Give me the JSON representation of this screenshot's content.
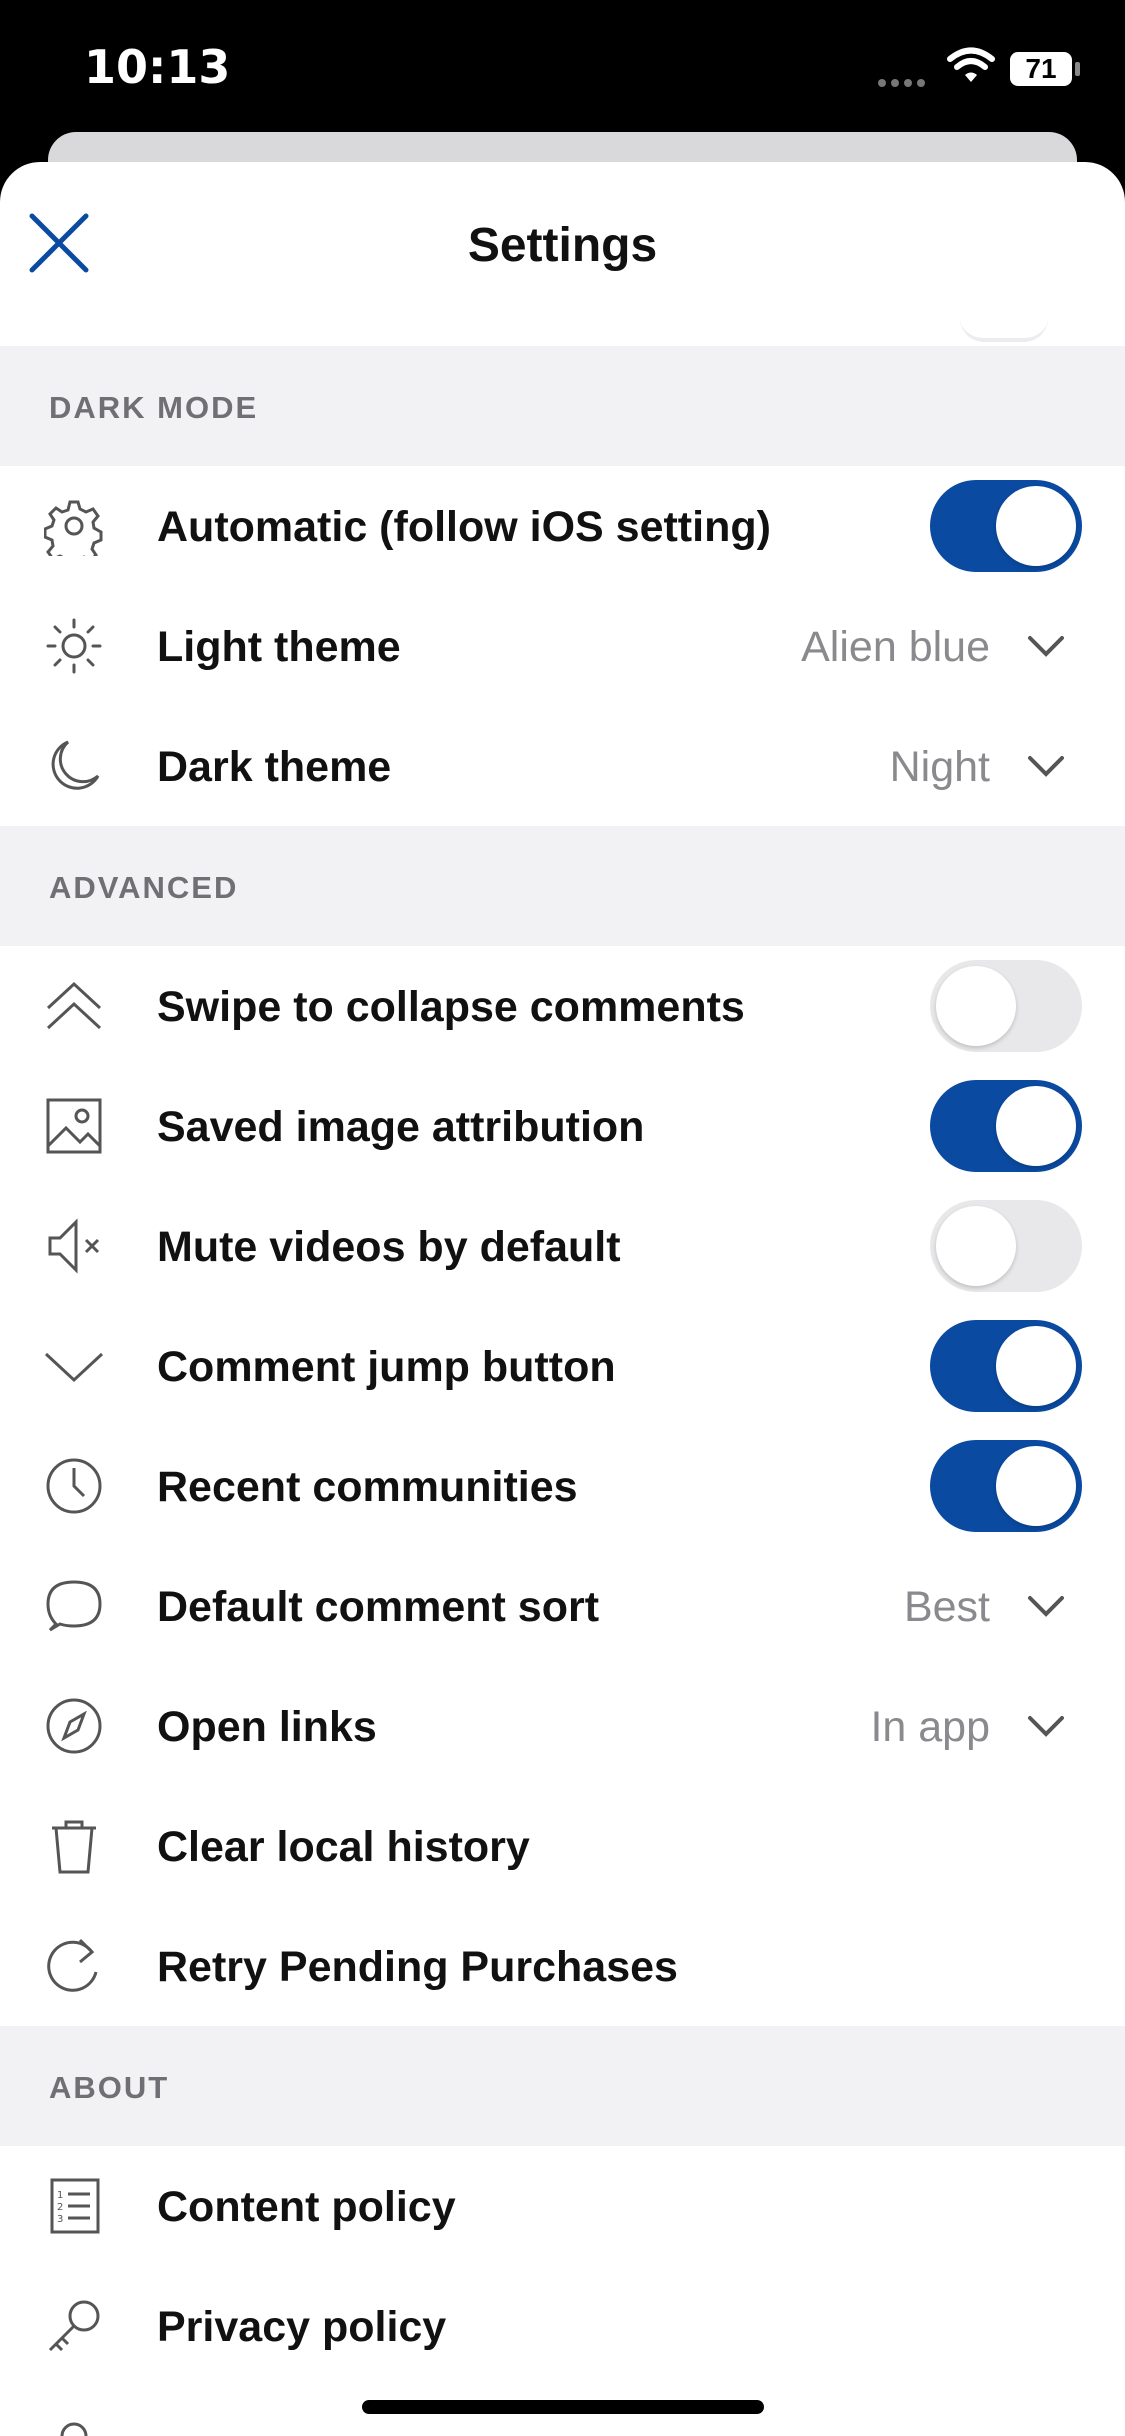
{
  "status_bar": {
    "time": "10:13",
    "battery": "71",
    "icons": [
      "cellular-signal-icon",
      "wifi-icon",
      "battery-icon"
    ]
  },
  "header": {
    "title": "Settings",
    "close_icon": "close-icon"
  },
  "colors": {
    "accent": "#0b4aa1",
    "section_bg": "#f2f2f4",
    "secondary_text": "#8a8a8e"
  },
  "sections": {
    "dark_mode": {
      "title": "DARK MODE",
      "automatic": {
        "label": "Automatic (follow iOS setting)",
        "icon": "gear-icon",
        "enabled": true
      },
      "light_theme": {
        "label": "Light theme",
        "icon": "sun-icon",
        "value": "Alien blue"
      },
      "dark_theme": {
        "label": "Dark theme",
        "icon": "moon-icon",
        "value": "Night"
      }
    },
    "advanced": {
      "title": "ADVANCED",
      "swipe_collapse": {
        "label": "Swipe to collapse comments",
        "icon": "double-chevron-up-icon",
        "enabled": false
      },
      "saved_image_attribution": {
        "label": "Saved image attribution",
        "icon": "image-icon",
        "enabled": true
      },
      "mute_videos": {
        "label": "Mute videos by default",
        "icon": "speaker-muted-icon",
        "enabled": false
      },
      "comment_jump": {
        "label": "Comment jump button",
        "icon": "chevron-down-icon",
        "enabled": true
      },
      "recent_communities": {
        "label": "Recent communities",
        "icon": "clock-icon",
        "enabled": true
      },
      "default_comment_sort": {
        "label": "Default comment sort",
        "icon": "speech-bubble-icon",
        "value": "Best"
      },
      "open_links": {
        "label": "Open links",
        "icon": "compass-icon",
        "value": "In app"
      },
      "clear_history": {
        "label": "Clear local history",
        "icon": "trash-icon"
      },
      "retry_purchases": {
        "label": "Retry Pending Purchases",
        "icon": "refresh-icon"
      }
    },
    "about": {
      "title": "ABOUT",
      "content_policy": {
        "label": "Content policy",
        "icon": "numbered-list-icon"
      },
      "privacy_policy": {
        "label": "Privacy policy",
        "icon": "key-icon"
      }
    }
  }
}
